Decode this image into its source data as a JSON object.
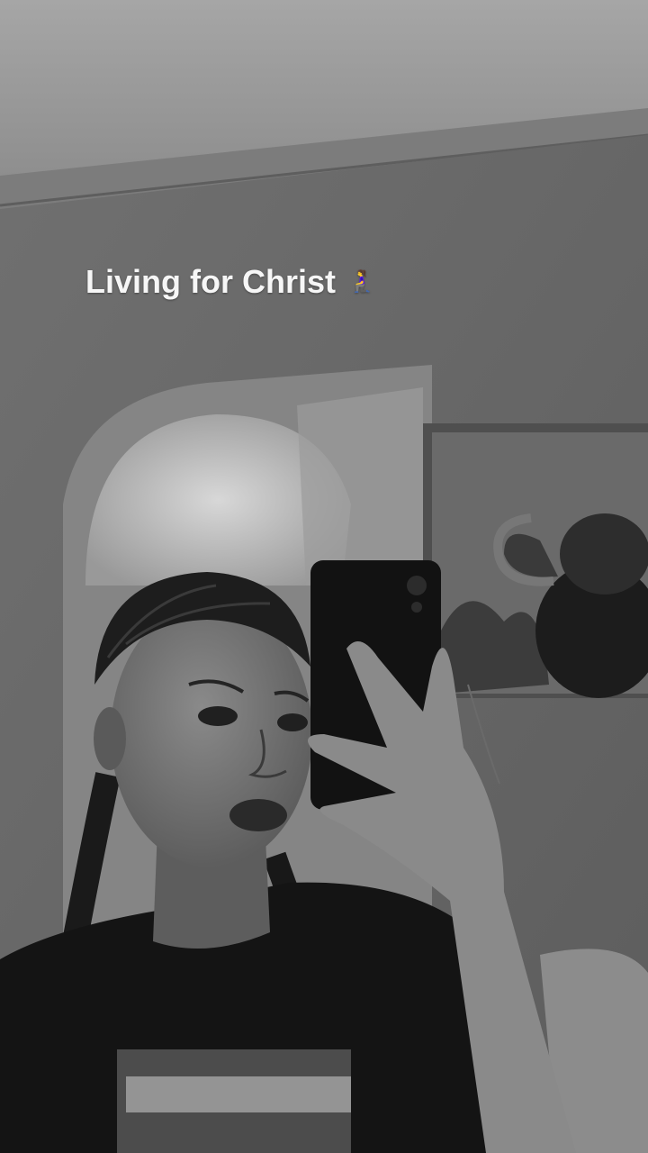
{
  "story": {
    "caption_text": "Living for Christ",
    "caption_emoji": "🧎‍♀️",
    "caption_emoji_name": "kneeling-woman-icon",
    "color_mode": "black-and-white photo"
  },
  "colors": {
    "caption": "#f6f6f6",
    "emoji_accent": "#b35bc4"
  }
}
